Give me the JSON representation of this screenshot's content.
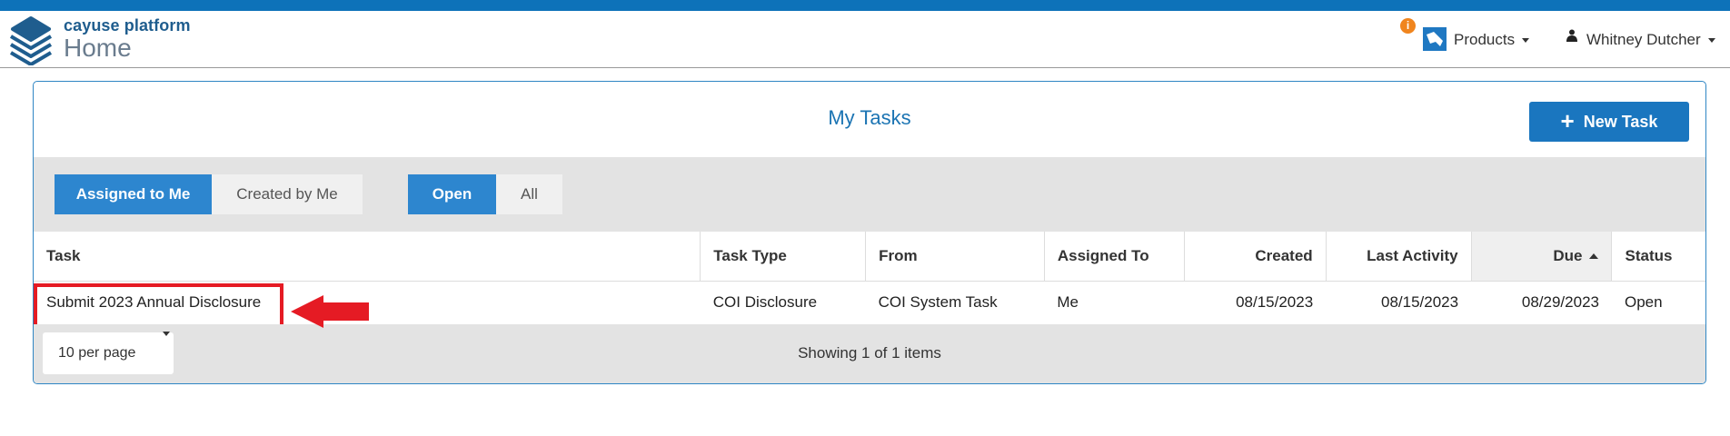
{
  "header": {
    "brand_platform": "cayuse platform",
    "brand_section": "Home",
    "notification_badge": "i",
    "products_label": "Products",
    "user_name": "Whitney Dutcher"
  },
  "panel": {
    "title": "My Tasks",
    "new_task_label": "New Task"
  },
  "filters": {
    "scope": [
      "Assigned to Me",
      "Created by Me"
    ],
    "scope_active": "Assigned to Me",
    "state": [
      "Open",
      "All"
    ],
    "state_active": "Open"
  },
  "table": {
    "columns": [
      "Task",
      "Task Type",
      "From",
      "Assigned To",
      "Created",
      "Last Activity",
      "Due",
      "Status"
    ],
    "sorted_column": "Due",
    "sort_direction": "ascending",
    "rows": [
      {
        "task": "Submit 2023 Annual Disclosure",
        "task_type": "COI Disclosure",
        "from": "COI System Task",
        "assigned_to": "Me",
        "created": "08/15/2023",
        "last_activity": "08/15/2023",
        "due": "08/29/2023",
        "status": "Open"
      }
    ]
  },
  "footer": {
    "per_page": "10 per page",
    "showing": "Showing 1 of 1 items"
  },
  "colors": {
    "brand_blue": "#0d72b9",
    "active_button": "#2d86cf",
    "highlight_red": "#e51b24",
    "badge_orange": "#f0851e"
  }
}
